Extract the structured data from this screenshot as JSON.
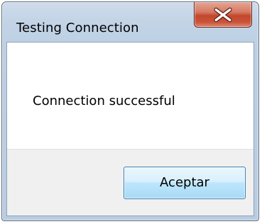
{
  "window": {
    "title": "Testing Connection"
  },
  "titlebar": {
    "close_icon": "close-x-icon"
  },
  "dialog": {
    "message": "Connection successful",
    "ok_label": "Aceptar"
  },
  "colors": {
    "close_button": "#c4472b",
    "ok_button_border": "#3c7fb1",
    "frame": "#bccfe3"
  }
}
